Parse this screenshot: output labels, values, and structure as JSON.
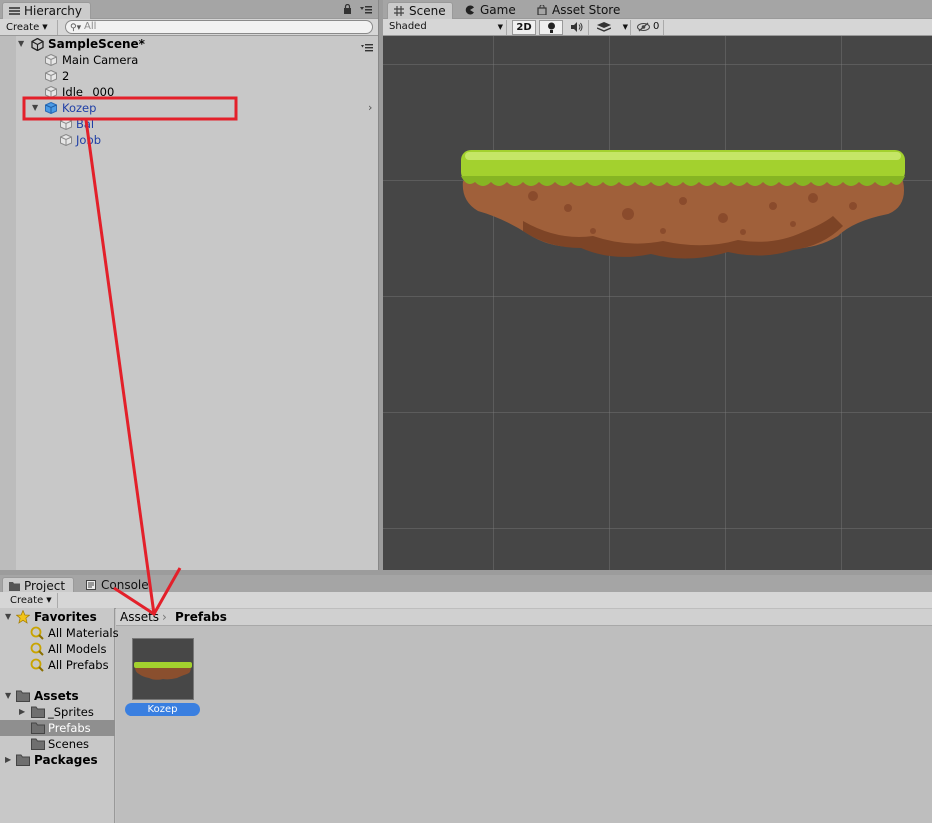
{
  "hierarchy": {
    "tab_label": "Hierarchy",
    "create_label": "Create",
    "search_placeholder": "All",
    "scene_name": "SampleScene*",
    "items": [
      {
        "label": "Main Camera"
      },
      {
        "label": "2"
      },
      {
        "label": "Idle _000"
      },
      {
        "label": "Kozep"
      },
      {
        "label": "Bal"
      },
      {
        "label": "Jobb"
      }
    ]
  },
  "scene_panel": {
    "tabs": [
      {
        "label": "Scene"
      },
      {
        "label": "Game"
      },
      {
        "label": "Asset Store"
      }
    ],
    "shading_mode": "Shaded",
    "mode_2d_label": "2D",
    "hidden_count": "0"
  },
  "project": {
    "tabs": [
      {
        "label": "Project"
      },
      {
        "label": "Console"
      }
    ],
    "create_label": "Create",
    "favorites": {
      "label": "Favorites",
      "items": [
        {
          "label": "All Materials"
        },
        {
          "label": "All Models"
        },
        {
          "label": "All Prefabs"
        }
      ]
    },
    "assets": {
      "label": "Assets",
      "items": [
        {
          "label": "_Sprites"
        },
        {
          "label": "Prefabs"
        },
        {
          "label": "Scenes"
        }
      ]
    },
    "packages_label": "Packages",
    "breadcrumb": {
      "root": "Assets",
      "current": "Prefabs"
    },
    "asset_items": [
      {
        "label": "Kozep"
      }
    ]
  },
  "colors": {
    "selected_asset": "#3a7fe0",
    "annotation": "#e3202a",
    "scene_background": "#464646",
    "grass": "#a3d12e",
    "dirt": "#a0603a"
  }
}
